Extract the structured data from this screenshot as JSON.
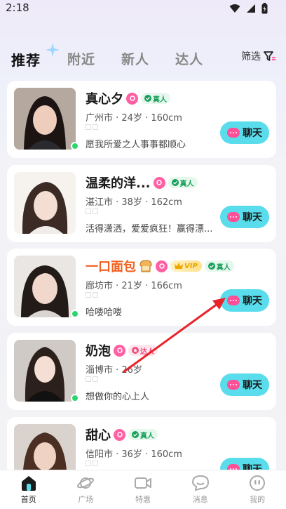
{
  "status": {
    "time": "2:18"
  },
  "tabs": [
    {
      "label": "推荐",
      "active": true
    },
    {
      "label": "附近",
      "active": false
    },
    {
      "label": "新人",
      "active": false
    },
    {
      "label": "达人",
      "active": false
    }
  ],
  "filter_label": "筛选",
  "badges": {
    "real": "真人",
    "talent": "达人",
    "vip": "VIP"
  },
  "chat_label": "聊天",
  "users": [
    {
      "name": "真心夕",
      "info": "广州市 · 24岁 · 160cm",
      "bio": "愿我所爱之人事事都顺心"
    },
    {
      "name": "温柔的洋...",
      "info": "湛江市 · 38岁 · 162cm",
      "bio": "活得潇洒，爱爱疯狂！赢得漂..."
    },
    {
      "name": "一口面包",
      "info": "廊坊市 · 21岁 · 166cm",
      "bio": "哈喽哈喽"
    },
    {
      "name": "奶泡",
      "info": "淄博市 · 26岁",
      "bio": "想做你的心上人"
    },
    {
      "name": "甜心",
      "info": "信阳市 · 36岁 · 160cm",
      "bio": ""
    }
  ],
  "nav": [
    {
      "label": "首页",
      "active": true
    },
    {
      "label": "广场",
      "active": false
    },
    {
      "label": "特惠",
      "active": false
    },
    {
      "label": "消息",
      "active": false
    },
    {
      "label": "我的",
      "active": false
    }
  ],
  "colors": {
    "accent": "#59dcec",
    "pink": "#ff4f97",
    "online": "#2bd66f",
    "vip_name": "#f2601e",
    "arrow": "#e8232a"
  }
}
